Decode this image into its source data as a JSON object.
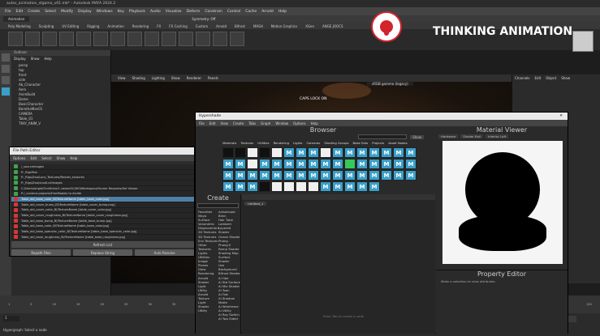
{
  "maya": {
    "window_title": "autos_animation_stgamo_v01.mb* - Autodesk MAYA 2024.2",
    "menus": [
      "File",
      "Edit",
      "Create",
      "Select",
      "Modify",
      "Display",
      "Windows",
      "Key",
      "Playback",
      "Audio",
      "Visualize",
      "Deform",
      "Constrain",
      "Control",
      "Cache",
      "Arnold",
      "Help"
    ],
    "mode": "Animation",
    "symmetry": "Symmetry: Off",
    "shelf_tabs": [
      "Poly Modeling",
      "Sculpting",
      "UV Editing",
      "Rigging",
      "Animation",
      "Rendering",
      "FX",
      "FX Caching",
      "Custom",
      "Arnold",
      "Bifrost",
      "MASH",
      "Motion Graphics",
      "XGen"
    ],
    "shelf_tab_extra": "ANGE JOOCS",
    "outliner": {
      "title": "Outliner",
      "menu": [
        "Display",
        "Show",
        "Help"
      ],
      "items": [
        "persp",
        "top",
        "front",
        "side",
        "Ab_Character",
        "Aero",
        "AnimBuild",
        "Dome",
        "BasicCharacter",
        "BeretheMan01",
        "CAMERA",
        "Table_01",
        "TRAY_ANIM_V"
      ]
    },
    "viewport": {
      "menu": [
        "View",
        "Shading",
        "Lighting",
        "Show",
        "Renderer",
        "Panels"
      ],
      "caption": "CAPS LOCK ON",
      "camera": "sRGB gamma (legacy)"
    },
    "channel_box": {
      "menu": [
        "Channels",
        "Edit",
        "Object",
        "Show"
      ]
    },
    "help_line": "Hypergraph: Select a node",
    "frames": [
      "1",
      "5",
      "10",
      "15",
      "20",
      "25",
      "30",
      "35",
      "40",
      "45",
      "50",
      "55",
      "60",
      "65",
      "70",
      "75",
      "80",
      "85",
      "90",
      "95",
      "100",
      "105",
      "110",
      "115",
      "120"
    ],
    "current_frame": "1"
  },
  "file_path_editor": {
    "title": "File Path Editor",
    "menu": [
      "Options",
      "Edit",
      "Select",
      "Show",
      "Help"
    ],
    "rows": [
      {
        "text": "/_sourceimages",
        "status": "ok",
        "selected": false
      },
      {
        "text": "P:_RigsTest",
        "status": "ok",
        "selected": false
      },
      {
        "text": "P:_Rigs/Zoo/Loco_Textures/Render_textures",
        "status": "ok",
        "selected": false
      },
      {
        "text": "P:_Rigs/Zoo/vnodi-v4images",
        "status": "ok",
        "selected": false
      },
      {
        "text": "C:/Users/angie/OneDrive/1 casinoSC/WO/Workspace/Sumer Requires/Set Viewer",
        "status": "ok",
        "selected": false
      },
      {
        "text": "P:/_content-projects/FreeModels to divide",
        "status": "ok",
        "selected": false
      },
      {
        "text": "Table_old_base_color_Bl/TextureName [table_base_color.jpg]",
        "status": "bad",
        "selected": true
      },
      {
        "text": "Table_old_cover_bump_Bl/TextureName [table_cover_bump.png]",
        "status": "bad",
        "selected": false
      },
      {
        "text": "Table_old_cover_color_Bl/TextureName [table_cover_color.jpg]",
        "status": "bad",
        "selected": false
      },
      {
        "text": "Table_old_cover_roughness_Bl/TextureName [table_cover_roughness.jpg]",
        "status": "bad",
        "selected": false
      },
      {
        "text": "Table_old_base_bump_Bl/TextureName [table_base_bump.jpg]",
        "status": "bad",
        "selected": false
      },
      {
        "text": "Table_old_base_color_Bl/TextureName [table_base_color.jpg]",
        "status": "bad",
        "selected": false
      },
      {
        "text": "Table_old_base_specular_color_Bl/TextureName [table_base_specular_color.jpg]",
        "status": "bad",
        "selected": false
      },
      {
        "text": "Table_old_base_roughness_Bl/TextureName [table_base_roughness.jpg]",
        "status": "bad",
        "selected": false
      }
    ],
    "refresh_label": "Refresh List",
    "repath_label": "Repath Files",
    "replace_label": "Replace String",
    "resolve_label": "Auto Resolve"
  },
  "hypershade": {
    "title": "Hypershade",
    "menu": [
      "File",
      "Edit",
      "View",
      "Create",
      "Tabs",
      "Graph",
      "Window",
      "Options",
      "Help"
    ],
    "browser_label": "Browser",
    "browser_tabs": [
      "Materials",
      "Textures",
      "Utilities",
      "Rendering",
      "Lights",
      "Cameras",
      "Shading Groups",
      "Bake Sets",
      "Projects",
      "Asset Nodes"
    ],
    "create_label": "Create",
    "create_categories": [
      "Favorites",
      "Maya",
      "Surface",
      "Volumetric",
      "Displacement",
      "2D Textures",
      "3D Textures",
      "Env Textures",
      "Other Textures",
      "Lights",
      "Utilities",
      "Image Planes",
      "Glow",
      "Rendering",
      "Arnold",
      "Shader",
      "Light",
      "Utility",
      "Arnold",
      "Texture",
      "Light",
      "Shader",
      "Utility"
    ],
    "create_nodes": [
      "Anisotropic",
      "Blinn",
      "Hair Tube",
      "Lambert",
      "Layered Shader",
      "Ocean Shader",
      "Phong",
      "Phong E",
      "Ramp Shader",
      "Shading Map",
      "Surface Shader",
      "Use Background",
      "Bifrost Shader",
      "Ai Hair",
      "Ai Std Surface",
      "Ai Mix Shader",
      "Ai Toon",
      "Ai Flat",
      "Ai Shadow Matte",
      "Ai Wireframe",
      "Ai Utility",
      "Ai Ray Switch",
      "Ai Two Sided"
    ],
    "tab_name": "Untitled_1",
    "hint": "Press Tab to create a node",
    "material_viewer_label": "Material Viewer",
    "mv_renderer": "Hardware",
    "mv_shape": "Shader Ball",
    "mv_env": "Interior Loft",
    "property_editor_label": "Property Editor",
    "property_hint": "Make a selection to view attributes.",
    "search_label": "Show"
  },
  "banner": {
    "text": "THINKING ANIMATION"
  },
  "colors": {
    "accent": "#3a9fc9",
    "banner_red": "#d3232b",
    "ok": "#3fa34d",
    "bad": "#d33838"
  }
}
